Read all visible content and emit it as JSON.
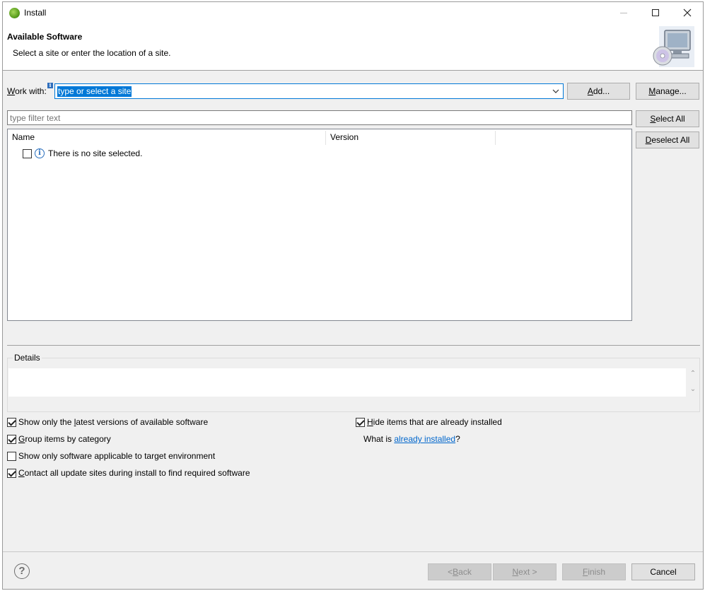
{
  "window": {
    "title": "Install",
    "header_title": "Available Software",
    "header_subtitle": "Select a site or enter the location of a site."
  },
  "work_with": {
    "label_accel": "W",
    "label_rest": "ork with:",
    "value": "type or select a site",
    "add_label_accel": "A",
    "add_label_rest": "dd...",
    "manage_label_accel": "M",
    "manage_label_rest": "anage..."
  },
  "filter": {
    "placeholder": "type filter text"
  },
  "selection_buttons": {
    "select_all_accel": "S",
    "select_all_rest": "elect All",
    "deselect_all_accel": "D",
    "deselect_all_rest": "eselect All"
  },
  "tree": {
    "columns": [
      "Name",
      "Version"
    ],
    "rows": [
      {
        "checked": false,
        "icon": "info-icon",
        "label": "There is no site selected."
      }
    ]
  },
  "details": {
    "label": "Details",
    "text": ""
  },
  "options": {
    "latest_versions": {
      "checked": true,
      "pre": "Show only the ",
      "accel": "l",
      "post": "atest versions of available software"
    },
    "group_by_category": {
      "checked": true,
      "pre": "",
      "accel": "G",
      "post": "roup items by category"
    },
    "target_env": {
      "checked": false,
      "pre": "Show only software applicable to target environment",
      "accel": "",
      "post": ""
    },
    "contact_sites": {
      "checked": true,
      "pre": "",
      "accel": "C",
      "post": "ontact all update sites during install to find required software"
    },
    "hide_installed": {
      "checked": true,
      "pre": "",
      "accel": "H",
      "post": "ide items that are already installed"
    }
  },
  "already_installed": {
    "prefix": "What is ",
    "link": "already installed",
    "suffix": "?"
  },
  "footer": {
    "back_pre": "< ",
    "back_accel": "B",
    "back_rest": "ack",
    "next_accel": "N",
    "next_rest": "ext >",
    "finish_accel": "F",
    "finish_rest": "inish",
    "cancel": "Cancel"
  }
}
